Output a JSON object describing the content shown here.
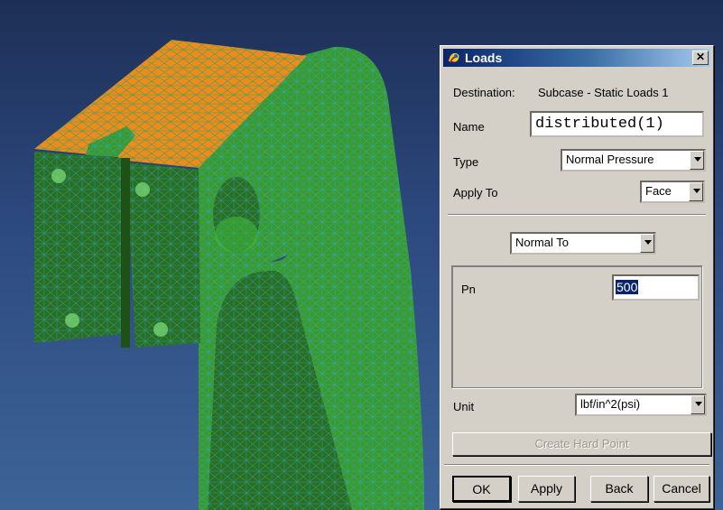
{
  "dialog": {
    "title": "Loads",
    "close_glyph": "✕",
    "destination_label": "Destination:",
    "destination_value": "Subcase - Static Loads 1",
    "name_label": "Name",
    "name_value": "distributed(1)",
    "type_label": "Type",
    "type_value": "Normal Pressure",
    "apply_to_label": "Apply To",
    "apply_to_value": "Face",
    "direction_value": "Normal To",
    "pn_label": "Pn",
    "pn_value": "500",
    "unit_label": "Unit",
    "unit_value": "lbf/in^2(psi)",
    "create_hard_point": "Create Hard Point",
    "buttons": {
      "ok": "OK",
      "apply": "Apply",
      "back": "Back",
      "cancel": "Cancel"
    }
  },
  "colors": {
    "mesh_green": "#3e9c2e",
    "selected_face_orange": "#f08a18",
    "title_bar": "#0a246a",
    "dialog_face": "#d4d0c8"
  }
}
